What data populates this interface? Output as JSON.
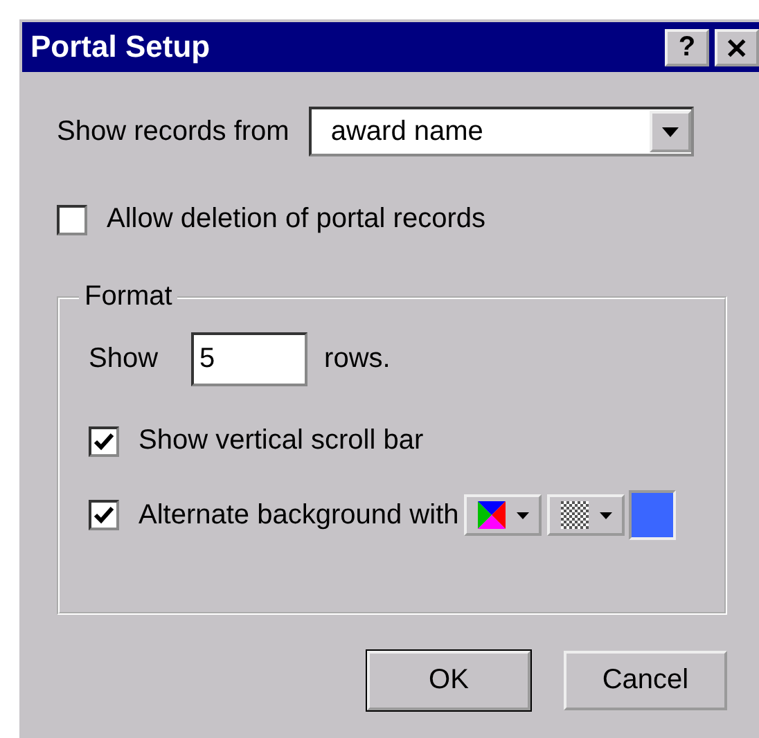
{
  "window": {
    "title": "Portal Setup",
    "help_button": "?",
    "close_button": "✕"
  },
  "records_source": {
    "label": "Show records from",
    "value": "award name"
  },
  "allow_deletion": {
    "label": "Allow deletion of portal records",
    "checked": false
  },
  "format": {
    "legend": "Format",
    "show_label": "Show",
    "rows_value": "5",
    "rows_suffix": "rows.",
    "options": [
      {
        "kind": "plain",
        "label": "Show vertical scroll bar",
        "checked": true
      },
      {
        "kind": "background",
        "label": "Alternate background with",
        "checked": true,
        "color": "#3a66ff"
      }
    ]
  },
  "buttons": [
    {
      "label": "OK",
      "default": true
    },
    {
      "label": "Cancel",
      "default": false
    }
  ]
}
